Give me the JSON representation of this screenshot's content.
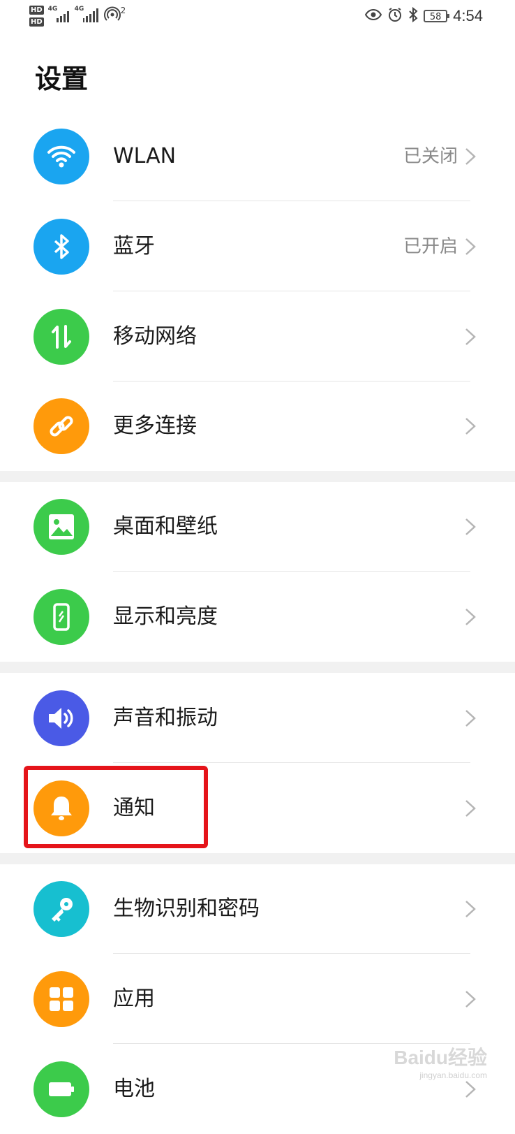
{
  "status_bar": {
    "hd1": "HD",
    "hd2": "HD",
    "net1": "4G",
    "net2": "4G",
    "hotspot_count": "2",
    "battery": "58",
    "time": "4:54"
  },
  "page": {
    "title": "设置"
  },
  "items": [
    {
      "label": "WLAN",
      "value": "已关闭",
      "icon": "wifi-icon",
      "color": "#1aa5f0"
    },
    {
      "label": "蓝牙",
      "value": "已开启",
      "icon": "bluetooth-icon",
      "color": "#1aa5f0"
    },
    {
      "label": "移动网络",
      "value": "",
      "icon": "mobile-data-icon",
      "color": "#3ccb4b"
    },
    {
      "label": "更多连接",
      "value": "",
      "icon": "link-icon",
      "color": "#ff9a0b"
    },
    {
      "label": "桌面和壁纸",
      "value": "",
      "icon": "image-icon",
      "color": "#3ccb4b"
    },
    {
      "label": "显示和亮度",
      "value": "",
      "icon": "phone-display-icon",
      "color": "#3ccb4b"
    },
    {
      "label": "声音和振动",
      "value": "",
      "icon": "speaker-icon",
      "color": "#4a5ae6"
    },
    {
      "label": "通知",
      "value": "",
      "icon": "bell-icon",
      "color": "#ff9a0b"
    },
    {
      "label": "生物识别和密码",
      "value": "",
      "icon": "key-icon",
      "color": "#17bfd0"
    },
    {
      "label": "应用",
      "value": "",
      "icon": "apps-grid-icon",
      "color": "#ff9a0b"
    },
    {
      "label": "电池",
      "value": "",
      "icon": "battery-icon",
      "color": "#3ccb4b"
    }
  ],
  "watermark": {
    "text": "Baidu经验",
    "sub": "jingyan.baidu.com"
  },
  "highlight_color": "#e5141a"
}
